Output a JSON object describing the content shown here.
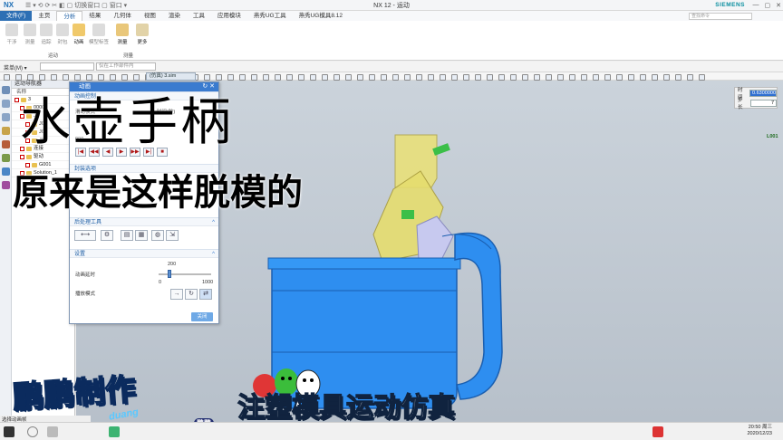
{
  "titlebar": {
    "app": "NX",
    "quick_tools": "☰ ▾ ⟲ ⟳ ✂ ◧ ▢ 切换窗口  ▢ 窗口 ▾",
    "window_title": "NX 12 - 运动",
    "brand": "SIEMENS"
  },
  "menu_tabs": [
    "文件(F)",
    "主页",
    "分析",
    "结果",
    "几何体",
    "视图",
    "渲染",
    "工具",
    "应用模块",
    "燕秀UG工具",
    "燕秀UG模具8.12"
  ],
  "search_placeholder": "查找命令",
  "ribbon": {
    "buttons": [
      "干涉",
      "测量",
      "追踪",
      "封包",
      "动画",
      "模型标签",
      "测量",
      "更多"
    ],
    "groups": [
      "运动",
      "测量"
    ]
  },
  "toolbar": {
    "menu_label": "菜单(M) ▾",
    "filter_placeholder": "仅在工作部件内"
  },
  "navigator": {
    "title": "运动导航器",
    "column": "名称",
    "rows": [
      {
        "label": "3",
        "indent": 0
      },
      {
        "label": "00000",
        "indent": 1
      },
      {
        "label": "J",
        "indent": 1
      },
      {
        "label": "J0",
        "indent": 2
      },
      {
        "label": "J0",
        "indent": 2
      },
      {
        "label": "J0",
        "indent": 2
      },
      {
        "label": "连接",
        "indent": 1
      },
      {
        "label": "驱动",
        "indent": 1
      },
      {
        "label": "G001",
        "indent": 2
      },
      {
        "label": "Solution_1",
        "indent": 1
      }
    ]
  },
  "viewport_tab": "(仿真) 3.sim",
  "time_panel": {
    "time_label": "时间",
    "time_value": "0.6300000",
    "step_label": "步长",
    "step_value": "7"
  },
  "axis_label": "L001",
  "dialog": {
    "title": "动画",
    "section_anim": "动画控制",
    "slider_label": "滑动模式",
    "time_label": "时间(秒)",
    "time_value": "000",
    "section_seal": "封装选项",
    "section_post": "后处理工具",
    "section_settings": "设置",
    "delay_label": "动画延时",
    "delay_value": "200",
    "delay_min": "0",
    "delay_max": "1000",
    "delay_fraction": 0.2,
    "play_mode_label": "播放模式",
    "close_label": "关闭",
    "play_buttons": [
      "|◀",
      "◀◀",
      "◀",
      "▶",
      "▶▶",
      "▶|",
      "■"
    ]
  },
  "captions": {
    "title1": "水壶手柄",
    "title2": "原来是这样脱模的",
    "author": "鹏鹏制作",
    "author_sub": "duang",
    "topic": "注塑模具运动仿真",
    "topic_badge": "鹏鹏"
  },
  "status": "选择动画帧",
  "clock": {
    "time": "20:50 周三",
    "date": "2020/12/23"
  },
  "colors": {
    "accent": "#3a7bcf",
    "part_blue": "#2e8ef0",
    "part_yellow": "#e9e07a",
    "part_lilac": "#c7c9ef",
    "pin_green": "#3bbf48"
  }
}
